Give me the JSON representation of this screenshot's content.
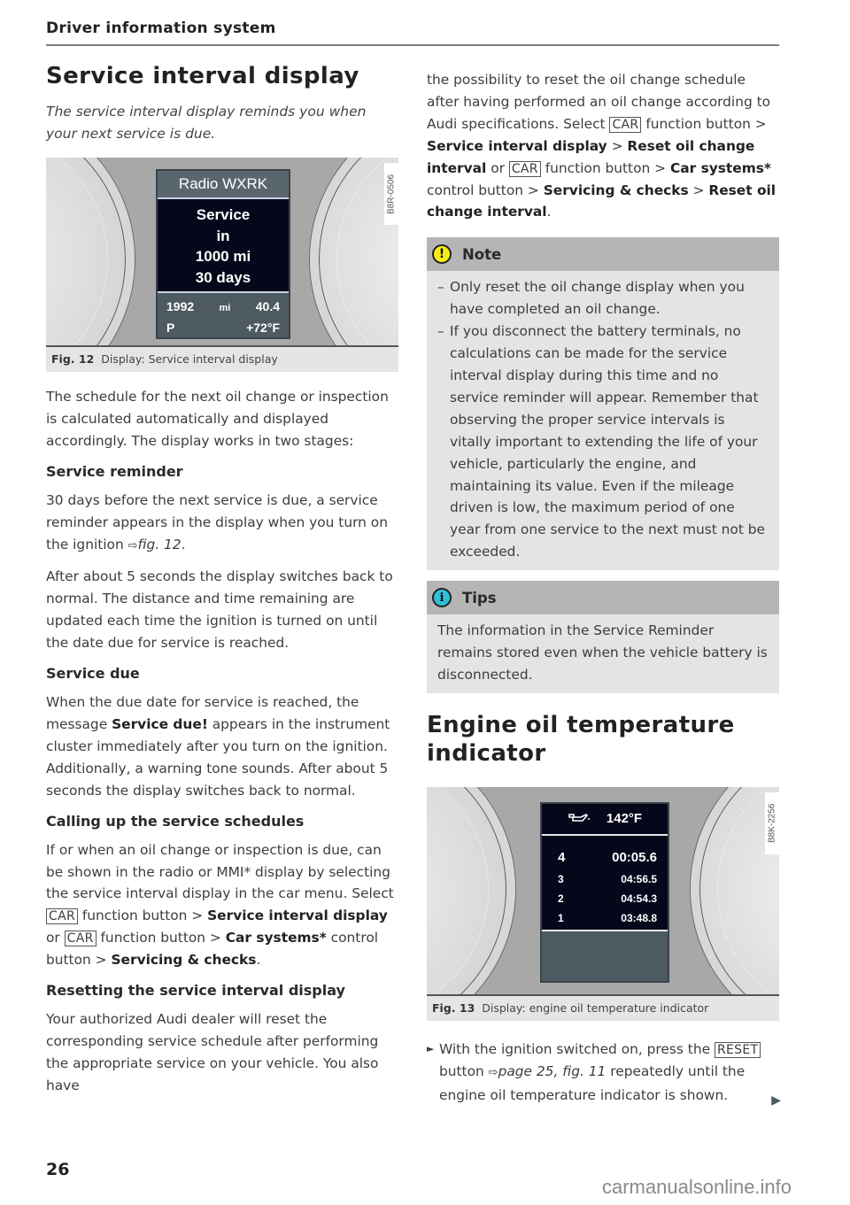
{
  "header": {
    "title": "Driver information system"
  },
  "left": {
    "title": "Service interval display",
    "intro": "The service interval display reminds you when your next service is due.",
    "figure12": {
      "code": "B8R-0506",
      "screen": {
        "top": "Radio WXRK",
        "lines": [
          "Service",
          "in",
          "1000 mi",
          "30 days"
        ],
        "odometer": "1992",
        "odometer_unit": "mi",
        "trip": "40.4",
        "gear": "P",
        "temp": "+72°F"
      },
      "caption_label": "Fig. 12",
      "caption_text": "Display: Service interval display"
    },
    "para1": "The schedule for the next oil change or inspection is calculated automatically and displayed accordingly. The display works in two stages:",
    "service_reminder": {
      "heading": "Service reminder",
      "p1_a": "30 days before the next service is due, a service reminder appears in the display when you turn on the ignition ",
      "p1_ref": "fig. 12",
      "p2": "After about 5 seconds the display switches back to normal. The distance and time remaining are updated each time the ignition is turned on until the date due for service is reached."
    },
    "service_due": {
      "heading": "Service due",
      "p_a": "When the due date for service is reached, the message ",
      "p_bold": "Service due!",
      "p_b": " appears in the instrument cluster immediately after you turn on the ignition. Additionally, a warning tone sounds. After about 5 seconds the display switches back to normal."
    },
    "calling": {
      "heading": "Calling up the service schedules",
      "p_a": "If or when an oil change or inspection is due, can be shown in the radio or MMI* display by selecting the service interval display in the car menu. Select ",
      "key": "CAR",
      "p_b": " function button > ",
      "b1": "Service interval display",
      "p_c": " or ",
      "p_d": " function button > ",
      "b2": "Car systems*",
      "p_e": " control button > ",
      "b3": "Servicing & checks",
      "p_f": "."
    },
    "resetting": {
      "heading": "Resetting the service interval display",
      "p": "Your authorized Audi dealer will reset the corresponding service schedule after performing the appropriate service on your vehicle. You also have"
    }
  },
  "right": {
    "cont": {
      "p_a": "the possibility to reset the oil change schedule after having performed an oil change according to Audi specifications. Select ",
      "key": "CAR",
      "p_b": " function button > ",
      "b1": "Service interval display",
      "p_c": " > ",
      "b2": "Reset oil change interval",
      "p_d": " or ",
      "p_e": " function button > ",
      "b3": "Car systems*",
      "p_f": " control button > ",
      "b4": "Servicing & checks",
      "p_g": " > ",
      "b5": "Reset oil change interval",
      "p_h": "."
    },
    "note": {
      "icon": "warning-exclamation-icon",
      "icon_glyph": "!",
      "title": "Note",
      "items": [
        "Only reset the oil change display when you have completed an oil change.",
        "If you disconnect the battery terminals, no calculations can be made for the service interval display during this time and no service reminder will appear. Remember that observing the proper service intervals is vitally important to extending the life of your vehicle, particularly the engine, and maintaining its value. Even if the mileage driven is low, the maximum period of one year from one service to the next must not be exceeded."
      ]
    },
    "tips": {
      "icon": "info-icon",
      "icon_glyph": "i",
      "title": "Tips",
      "text": "The information in the Service Reminder remains stored even when the vehicle battery is disconnected."
    },
    "engine_title": "Engine oil temperature indicator",
    "figure13": {
      "code": "B8K-2256",
      "screen": {
        "oil_icon": "oil-can-icon",
        "temp": "142°F",
        "laps": [
          {
            "n": "4",
            "time": "00:05.6"
          },
          {
            "n": "3",
            "time": "04:56.5"
          },
          {
            "n": "2",
            "time": "04:54.3"
          },
          {
            "n": "1",
            "time": "03:48.8"
          }
        ]
      },
      "caption_label": "Fig. 13",
      "caption_text": "Display: engine oil temperature indicator"
    },
    "step": {
      "bullet": "►",
      "p_a": "With the ignition switched on, press the ",
      "key": "RESET",
      "p_b": " button ",
      "ref": "page 25, fig. 11",
      "p_c": " repeatedly until the engine oil temperature indicator is shown.",
      "cont_arrow": "▶"
    }
  },
  "footer": {
    "page_number": "26",
    "watermark": "carmanualsonline.info"
  },
  "ref_arrow": "⇨"
}
